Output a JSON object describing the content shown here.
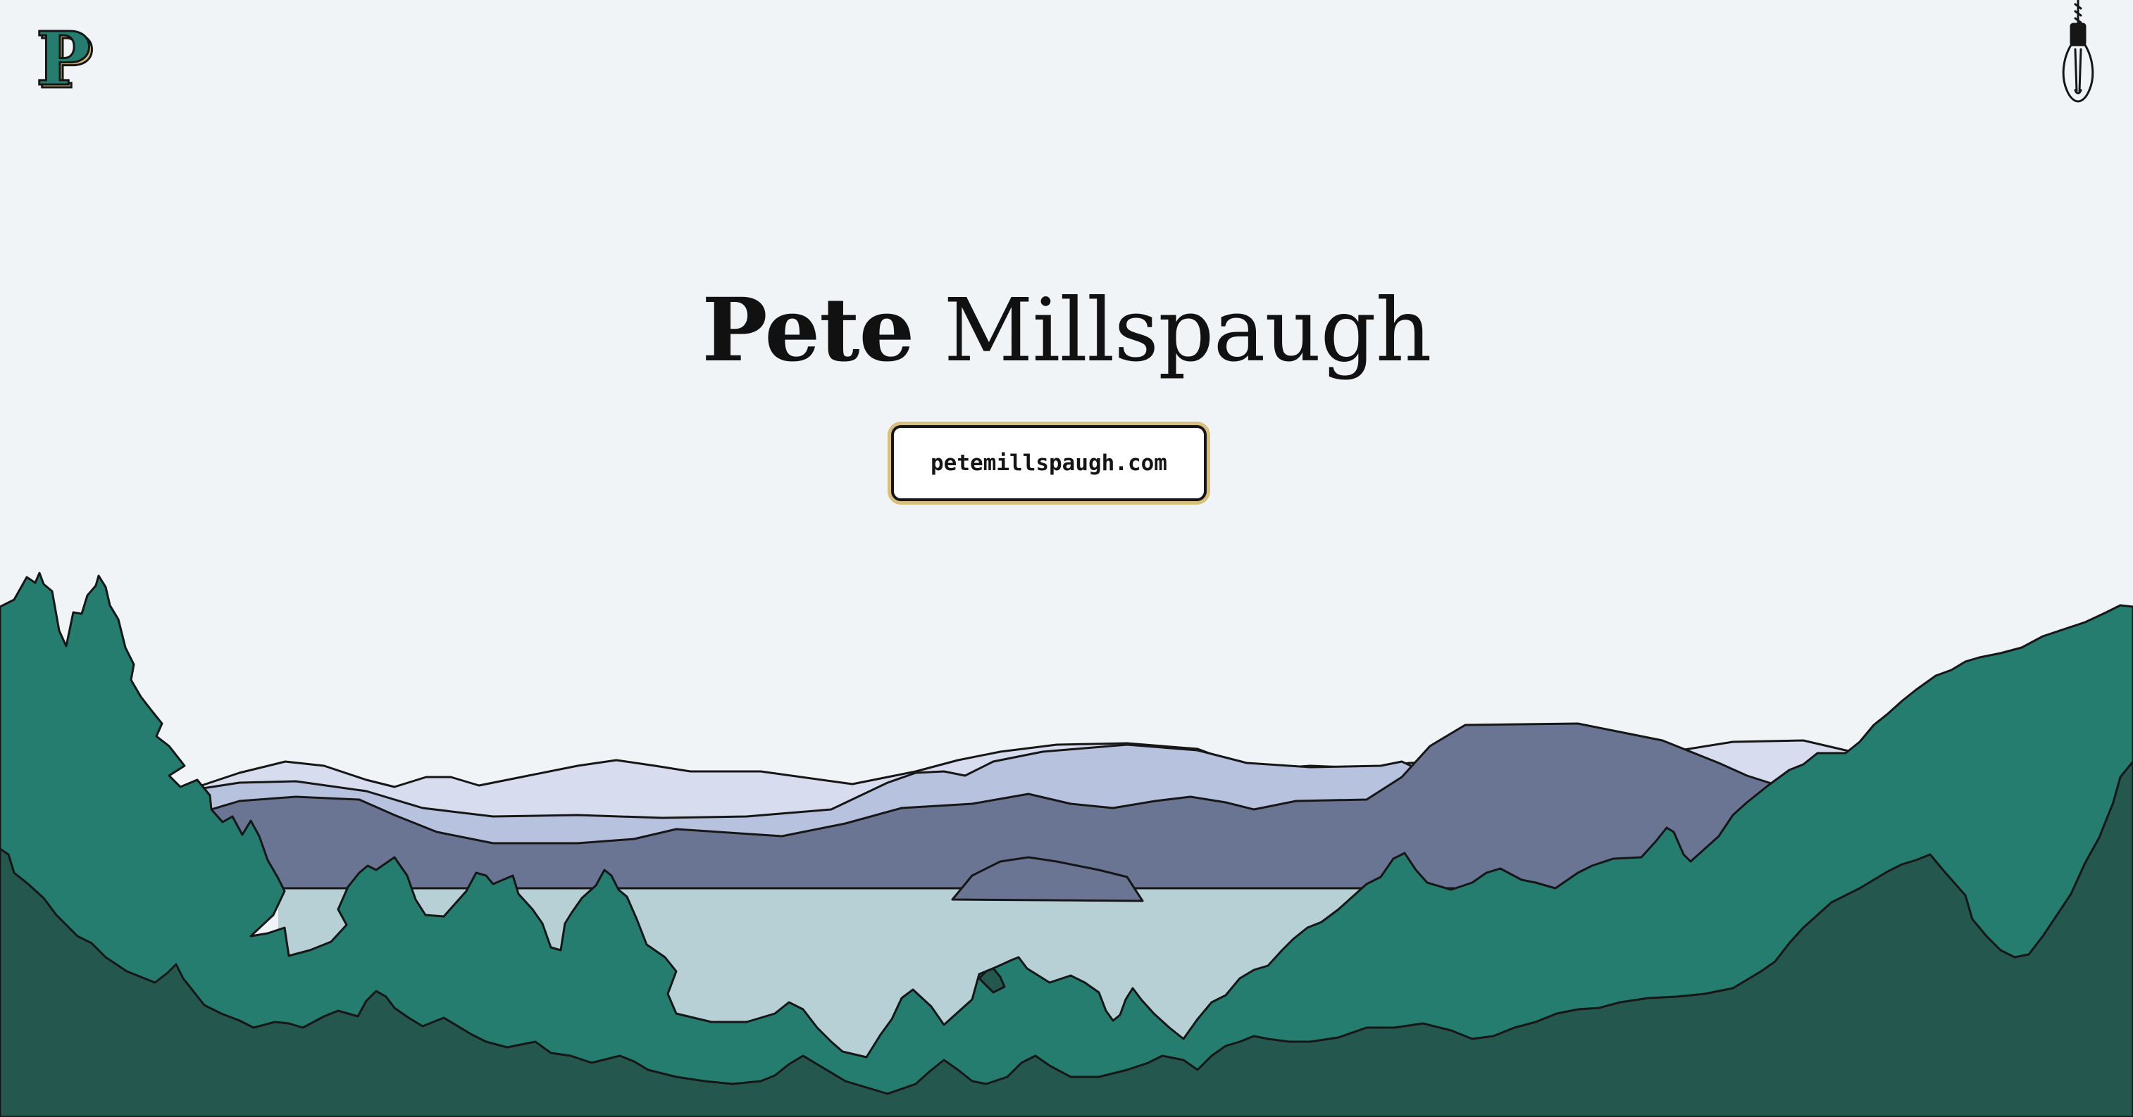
{
  "header": {
    "logo_letter": "P",
    "logo_icon": "p-monogram-logo",
    "theme_toggle_icon": "light-bulb-icon"
  },
  "hero": {
    "first_name": "Pete",
    "last_name": "Millspaugh",
    "url_button_label": "petemillspaugh.com"
  },
  "illustration": {
    "subject": "mountain-lake-forest-landscape",
    "colors": {
      "background": "#f0f4f7",
      "far_mountains": "#d7dcee",
      "mid_mountains": "#b7c2de",
      "near_mountains": "#697593",
      "lake": "#b7d0d5",
      "forest": "#247d6f",
      "foreground_forest": "#24584e",
      "outline": "#161616",
      "button_glow": "#d8bf7c"
    }
  }
}
